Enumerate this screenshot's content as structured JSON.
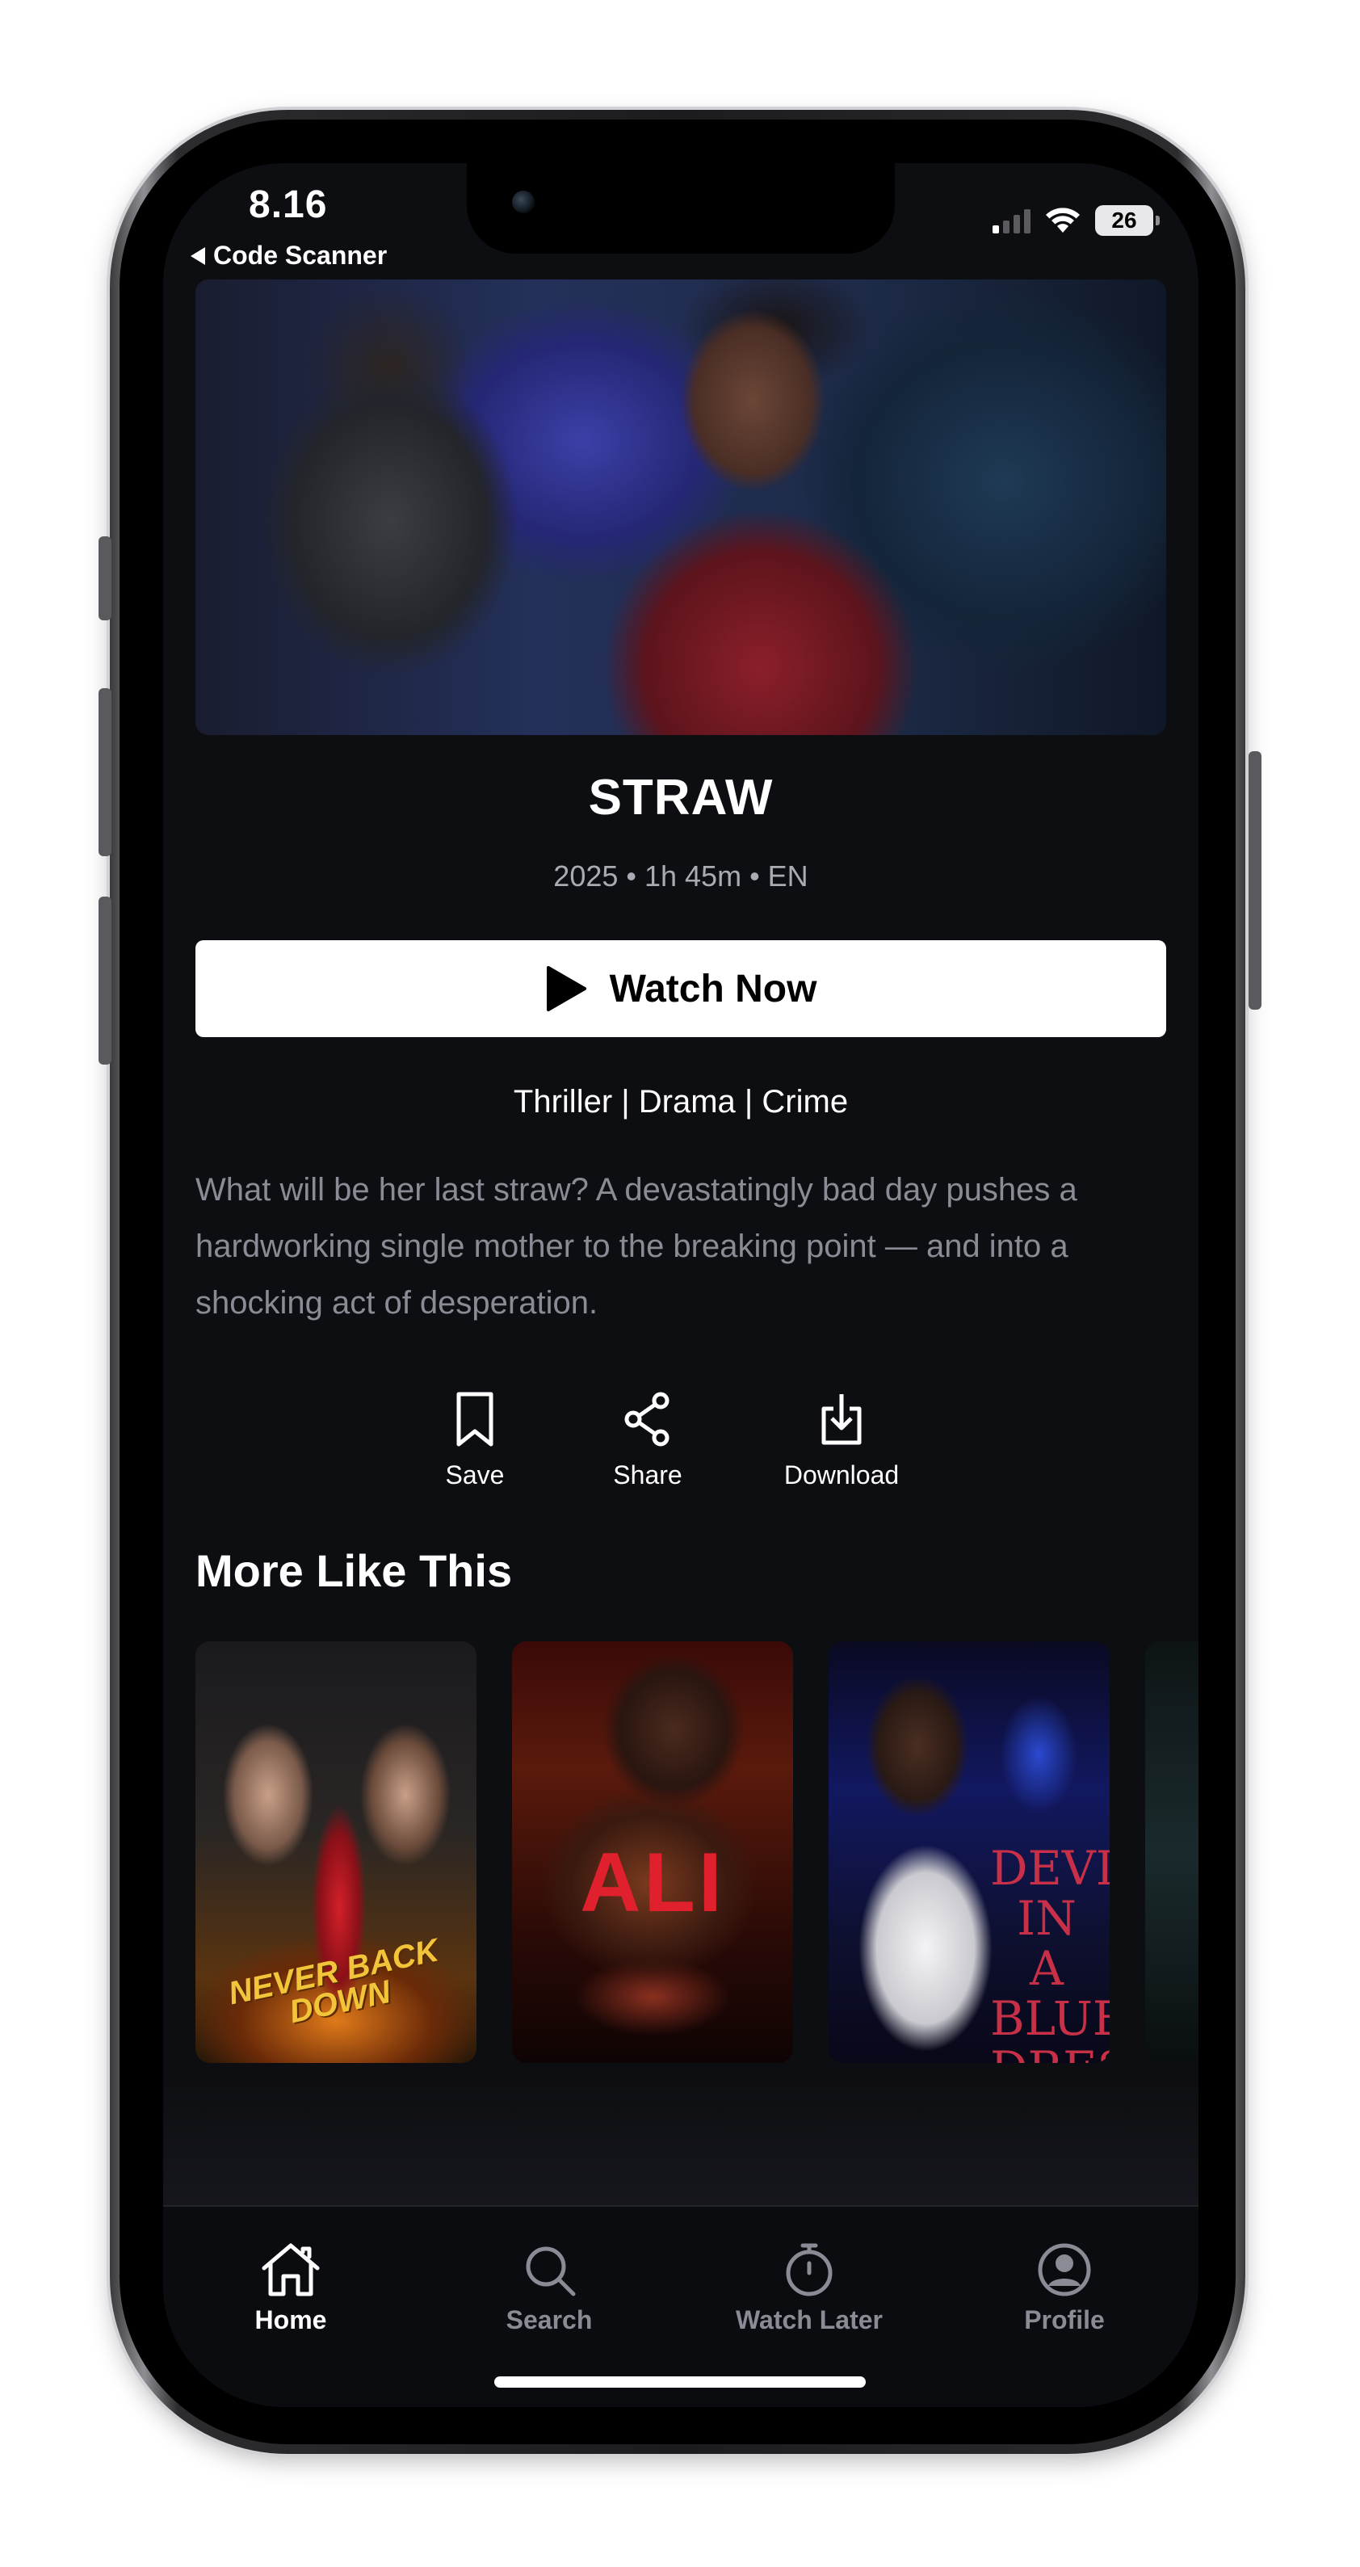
{
  "status_bar": {
    "time": "8.16",
    "back_label": "Code Scanner",
    "battery": "26"
  },
  "movie": {
    "title": "STRAW",
    "meta": "2025 • 1h 45m • EN",
    "watch_label": "Watch Now",
    "genres": "Thriller | Drama | Crime",
    "description": "What will be her last straw? A devastatingly bad day pushes a hardworking single mother to the breaking point — and into a shocking act of desperation."
  },
  "actions": [
    {
      "label": "Save",
      "icon": "bookmark-icon"
    },
    {
      "label": "Share",
      "icon": "share-icon"
    },
    {
      "label": "Download",
      "icon": "download-icon"
    }
  ],
  "more_like_this": {
    "title": "More Like This",
    "posters": [
      {
        "poster_title": "NEVER BACK DOWN"
      },
      {
        "poster_title": "ALI"
      },
      {
        "poster_title": "DEVIL IN A BLUE DRESS",
        "poster_subtitle": "IN A"
      }
    ]
  },
  "tab_bar": {
    "tabs": [
      {
        "label": "Home",
        "icon": "home-icon",
        "active": true
      },
      {
        "label": "Search",
        "icon": "search-icon",
        "active": false
      },
      {
        "label": "Watch Later",
        "icon": "stopwatch-icon",
        "active": false
      },
      {
        "label": "Profile",
        "icon": "profile-icon",
        "active": false
      }
    ]
  },
  "colors": {
    "background": "#0d0e12",
    "muted_text": "#8a8c95",
    "button_bg": "#ffffff",
    "poster_red": "#e0202c"
  }
}
